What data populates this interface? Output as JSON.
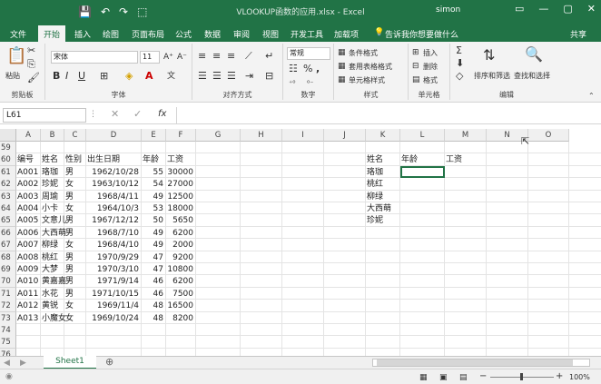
{
  "window": {
    "title": "VLOOKUP函数的应用.xlsx  -  Excel",
    "user": "simon",
    "quick_access": [
      "💾",
      "↶",
      "↷",
      "⬚"
    ],
    "controls": [
      "▭",
      "—",
      "▢",
      "✕"
    ]
  },
  "tabs": [
    "文件",
    "开始",
    "插入",
    "绘图",
    "页面布局",
    "公式",
    "数据",
    "审阅",
    "视图",
    "开发工具",
    "加载项"
  ],
  "tell_me": "告诉我你想要做什么",
  "share": "共享",
  "ribbon": {
    "paste": "粘贴",
    "clipboard": "剪贴板",
    "font_name": "宋体",
    "font_size": "11",
    "font_label": "字体",
    "align_label": "对齐方式",
    "number_format": "常规",
    "number_label": "数字",
    "conditional_format": "条件格式",
    "table_format": "套用表格格式",
    "cell_styles": "单元格样式",
    "styles_label": "样式",
    "insert": "插入",
    "delete": "删除",
    "format": "格式",
    "cells_label": "单元格",
    "sort_filter": "排序和筛选",
    "find_select": "查找和选择",
    "edit_label": "编辑"
  },
  "formula": {
    "name_box": "L61",
    "fx": "fx",
    "value": ""
  },
  "columns": [
    "A",
    "B",
    "C",
    "D",
    "E",
    "F",
    "G",
    "H",
    "I",
    "J",
    "K",
    "L",
    "M",
    "N",
    "O"
  ],
  "row_numbers": [
    "59",
    "60",
    "61",
    "62",
    "63",
    "64",
    "65",
    "66",
    "67",
    "68",
    "69",
    "70",
    "71",
    "72",
    "73",
    "74",
    "75",
    "76"
  ],
  "headers": {
    "id": "编号",
    "name": "姓名",
    "gender": "性别",
    "birth": "出生日期",
    "age": "年龄",
    "salary": "工资"
  },
  "rows": [
    [
      "A001",
      "珞珈",
      "男",
      "1962/10/28",
      "55",
      "30000"
    ],
    [
      "A002",
      "珍妮",
      "女",
      "1963/10/12",
      "54",
      "27000"
    ],
    [
      "A003",
      "周瑜",
      "男",
      "1968/4/11",
      "49",
      "12500"
    ],
    [
      "A004",
      "小卡",
      "女",
      "1964/10/3",
      "53",
      "18000"
    ],
    [
      "A005",
      "文意儿",
      "男",
      "1967/12/12",
      "50",
      "5650"
    ],
    [
      "A006",
      "大西萌",
      "男",
      "1968/7/10",
      "49",
      "6200"
    ],
    [
      "A007",
      "柳绿",
      "女",
      "1968/4/10",
      "49",
      "2000"
    ],
    [
      "A008",
      "桃红",
      "男",
      "1970/9/29",
      "47",
      "9200"
    ],
    [
      "A009",
      "大梦",
      "男",
      "1970/3/10",
      "47",
      "10800"
    ],
    [
      "A010",
      "黄嘉嘉",
      "男",
      "1971/9/14",
      "46",
      "6200"
    ],
    [
      "A011",
      "水花",
      "男",
      "1971/10/15",
      "46",
      "7500"
    ],
    [
      "A012",
      "黄锐",
      "女",
      "1969/11/4",
      "48",
      "16500"
    ],
    [
      "A013",
      "小魔女",
      "女",
      "1969/10/24",
      "48",
      "8200"
    ]
  ],
  "lookup": {
    "headers": [
      "姓名",
      "年龄",
      "工资"
    ],
    "names": [
      "珞珈",
      "桃红",
      "柳绿",
      "大西萌",
      "珍妮"
    ]
  },
  "sheet": {
    "name": "Sheet1",
    "add": "⊕"
  },
  "status": {
    "zoom": "100%"
  }
}
